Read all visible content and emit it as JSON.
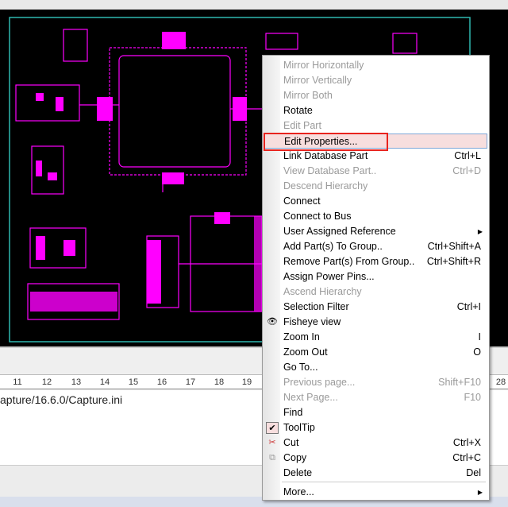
{
  "colors": {
    "canvas": "#000000",
    "wire": "#ff00ff",
    "border": "#2fb8b0",
    "highlight_box": "#e8231e"
  },
  "ruler": {
    "ticks": [
      "11",
      "12",
      "13",
      "14",
      "15",
      "16",
      "17",
      "18",
      "19",
      "28"
    ]
  },
  "output": {
    "text": "apture/16.6.0/Capture.ini"
  },
  "menu": {
    "items": [
      {
        "label": "Mirror Horizontally",
        "disabled": true
      },
      {
        "label": "Mirror Vertically",
        "disabled": true
      },
      {
        "label": "Mirror Both",
        "disabled": true
      },
      {
        "label": "Rotate"
      },
      {
        "label": "Edit Part",
        "disabled": true
      },
      {
        "label": "Edit Properties...",
        "highlighted": true
      },
      {
        "label": "Link Database Part",
        "shortcut": "Ctrl+L"
      },
      {
        "label": "View Database Part..",
        "shortcut": "Ctrl+D",
        "disabled": true
      },
      {
        "label": "Descend Hierarchy",
        "disabled": true
      },
      {
        "label": "Connect"
      },
      {
        "label": "Connect to Bus"
      },
      {
        "label": "User Assigned Reference",
        "submenu": true
      },
      {
        "label": "Add Part(s) To Group..",
        "shortcut": "Ctrl+Shift+A"
      },
      {
        "label": "Remove Part(s) From Group..",
        "shortcut": "Ctrl+Shift+R"
      },
      {
        "label": "Assign Power Pins..."
      },
      {
        "label": "Ascend Hierarchy",
        "disabled": true
      },
      {
        "label": "Selection Filter",
        "shortcut": "Ctrl+I"
      },
      {
        "label": "Fisheye view",
        "icon": "eye-icon"
      },
      {
        "label": "Zoom In",
        "shortcut": "I"
      },
      {
        "label": "Zoom Out",
        "shortcut": "O"
      },
      {
        "label": "Go To..."
      },
      {
        "label": "Previous page...",
        "shortcut": "Shift+F10",
        "disabled": true
      },
      {
        "label": "Next Page...",
        "shortcut": "F10",
        "disabled": true
      },
      {
        "label": "Find"
      },
      {
        "label": "ToolTip",
        "icon": "checkmark-icon",
        "checked": true
      },
      {
        "label": "Cut",
        "shortcut": "Ctrl+X",
        "icon": "scissors-icon"
      },
      {
        "label": "Copy",
        "shortcut": "Ctrl+C",
        "icon": "copy-icon"
      },
      {
        "label": "Delete",
        "shortcut": "Del"
      },
      {
        "label": "More...",
        "submenu": true
      }
    ]
  }
}
